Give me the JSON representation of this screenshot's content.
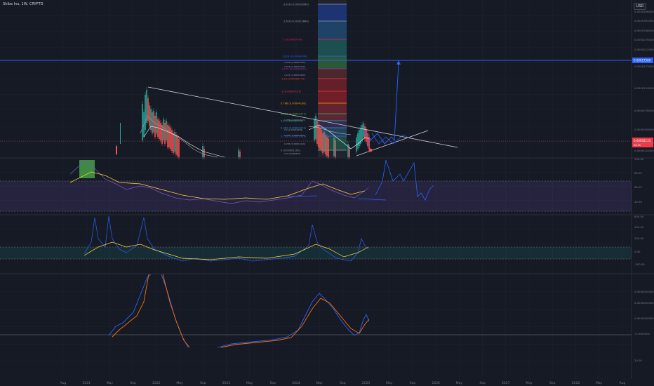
{
  "header": {
    "title": "Shiba Inu, 1W, CRYPTO",
    "currency_button": "USD"
  },
  "colors": {
    "background": "#161a25",
    "grid": "#1f2331",
    "axis_text": "#787b86",
    "fib_blue": "#2962ff",
    "rsi_fill": "#7e57c2",
    "cci_fill": "#26a69a",
    "macd": "#2962ff",
    "signal": "#ff6d00",
    "price_line": "#f23645",
    "drawing": "#2962ff"
  },
  "chart_data": [
    {
      "type": "line",
      "panel": "price",
      "title": "Shiba Inu, 1W, CRYPTO",
      "yscale": "log",
      "ylim": [
        6e-06,
        0.00011
      ],
      "y_ticks": [
        "0.00004560000",
        "0.00003920000",
        "0.00003460000",
        "0.00002700000",
        "0.00002120000",
        "0.00001730000",
        "0.00001190000",
        "0.00000760000",
        "0.00000490000",
        "0.00000270000",
        "0.00000140000"
      ],
      "current_price_label": "0.00002133",
      "current_price_label_2": "5d 5h",
      "highlight_price_label": "0.00017300",
      "fib_levels": [
        {
          "label": "3.618 (0.00016960)",
          "color": "#9598a1"
        },
        {
          "label": "2.618 (0.00012864)",
          "color": "#9598a1"
        },
        {
          "label": "2 (0.00009976)",
          "color": "#e91e63"
        },
        {
          "label": "1.618 (0.00008204)",
          "color": "#2962ff"
        },
        {
          "label": "1.272 (0.00006524)",
          "color": "#9c27b0"
        },
        {
          "label": "1.13 (0.00005775)",
          "color": "#f23645"
        },
        {
          "label": "1 (0.00005137)",
          "color": "#f23645"
        },
        {
          "label": "0.786 (0.00004108)",
          "color": "#ff9800"
        },
        {
          "label": "0.618 (0.00003377)",
          "color": "#4caf50"
        },
        {
          "label": "0.5 (0.00002953)",
          "color": "#26a69a"
        },
        {
          "label": "0.382 (0.00002473)",
          "color": "#2196f3"
        },
        {
          "label": "0.236 (0.00001963)",
          "color": "#2962ff"
        },
        {
          "label": "0 (0.00001100)",
          "color": "#9598a1"
        }
      ],
      "channel_labels": [
        "0 (0.00000975)",
        "1.272 (0.00001800)",
        "2.618 (0.00002450)",
        "1.618 (0.00002100)",
        "0.786 (0.00002043)",
        "0.5 (0.00001838)",
        "0.382 (0.00001632)",
        "0.236 (0.00001419)"
      ],
      "series": [
        {
          "name": "",
          "x": [
            "2021-01",
            "2021-04",
            "2021-08",
            "2021-10-25",
            "2021-11",
            "2022-01",
            "2022-03",
            "2022-06",
            "2022-09",
            "2023-01",
            "2023-06",
            "2023-10",
            "2024-01",
            "2024-03-05",
            "2024-05",
            "2024-08",
            "2024-10",
            "2024-12-08",
            "2025-01"
          ],
          "values": [
            1e-08,
            9e-06,
            7e-06,
            8.8e-05,
            5.2e-05,
            2.8e-05,
            2.6e-05,
            1e-05,
            1.2e-05,
            8.5e-06,
            7.2e-06,
            7.5e-06,
            9.5e-06,
            4.5e-05,
            2.6e-05,
            1.4e-05,
            1.8e-05,
            3.3e-05,
            2.2e-05
          ]
        }
      ]
    },
    {
      "type": "line",
      "panel": "rsi",
      "ylim": [
        30,
        100
      ],
      "y_ticks": [
        "100.00",
        "80.00",
        "60.00",
        "40.00"
      ],
      "band": [
        40,
        70
      ]
    },
    {
      "type": "line",
      "panel": "cci",
      "ylim": [
        -200,
        600
      ],
      "y_ticks": [
        "600.00",
        "400.00",
        "200.00",
        "0.00",
        "-200.00"
      ],
      "band": [
        -100,
        100
      ]
    },
    {
      "type": "line",
      "panel": "macd",
      "y_ticks": [
        "0.00000040000",
        "0.00000020000",
        "0.00000000000",
        "-0.0000000"
      ],
      "series": [
        {
          "name": "",
          "color": "#2962ff"
        },
        {
          "name": "",
          "color": "#ff6d00"
        }
      ]
    }
  ],
  "time_axis": {
    "labels": [
      "Aug",
      "2021",
      "May",
      "Sep",
      "2022",
      "May",
      "Sep",
      "2023",
      "May",
      "Sep",
      "2024",
      "May",
      "Sep",
      "2025",
      "May",
      "Sep",
      "2026",
      "May",
      "Sep",
      "2027",
      "May",
      "Sep",
      "2028",
      "May",
      "Aug"
    ]
  }
}
